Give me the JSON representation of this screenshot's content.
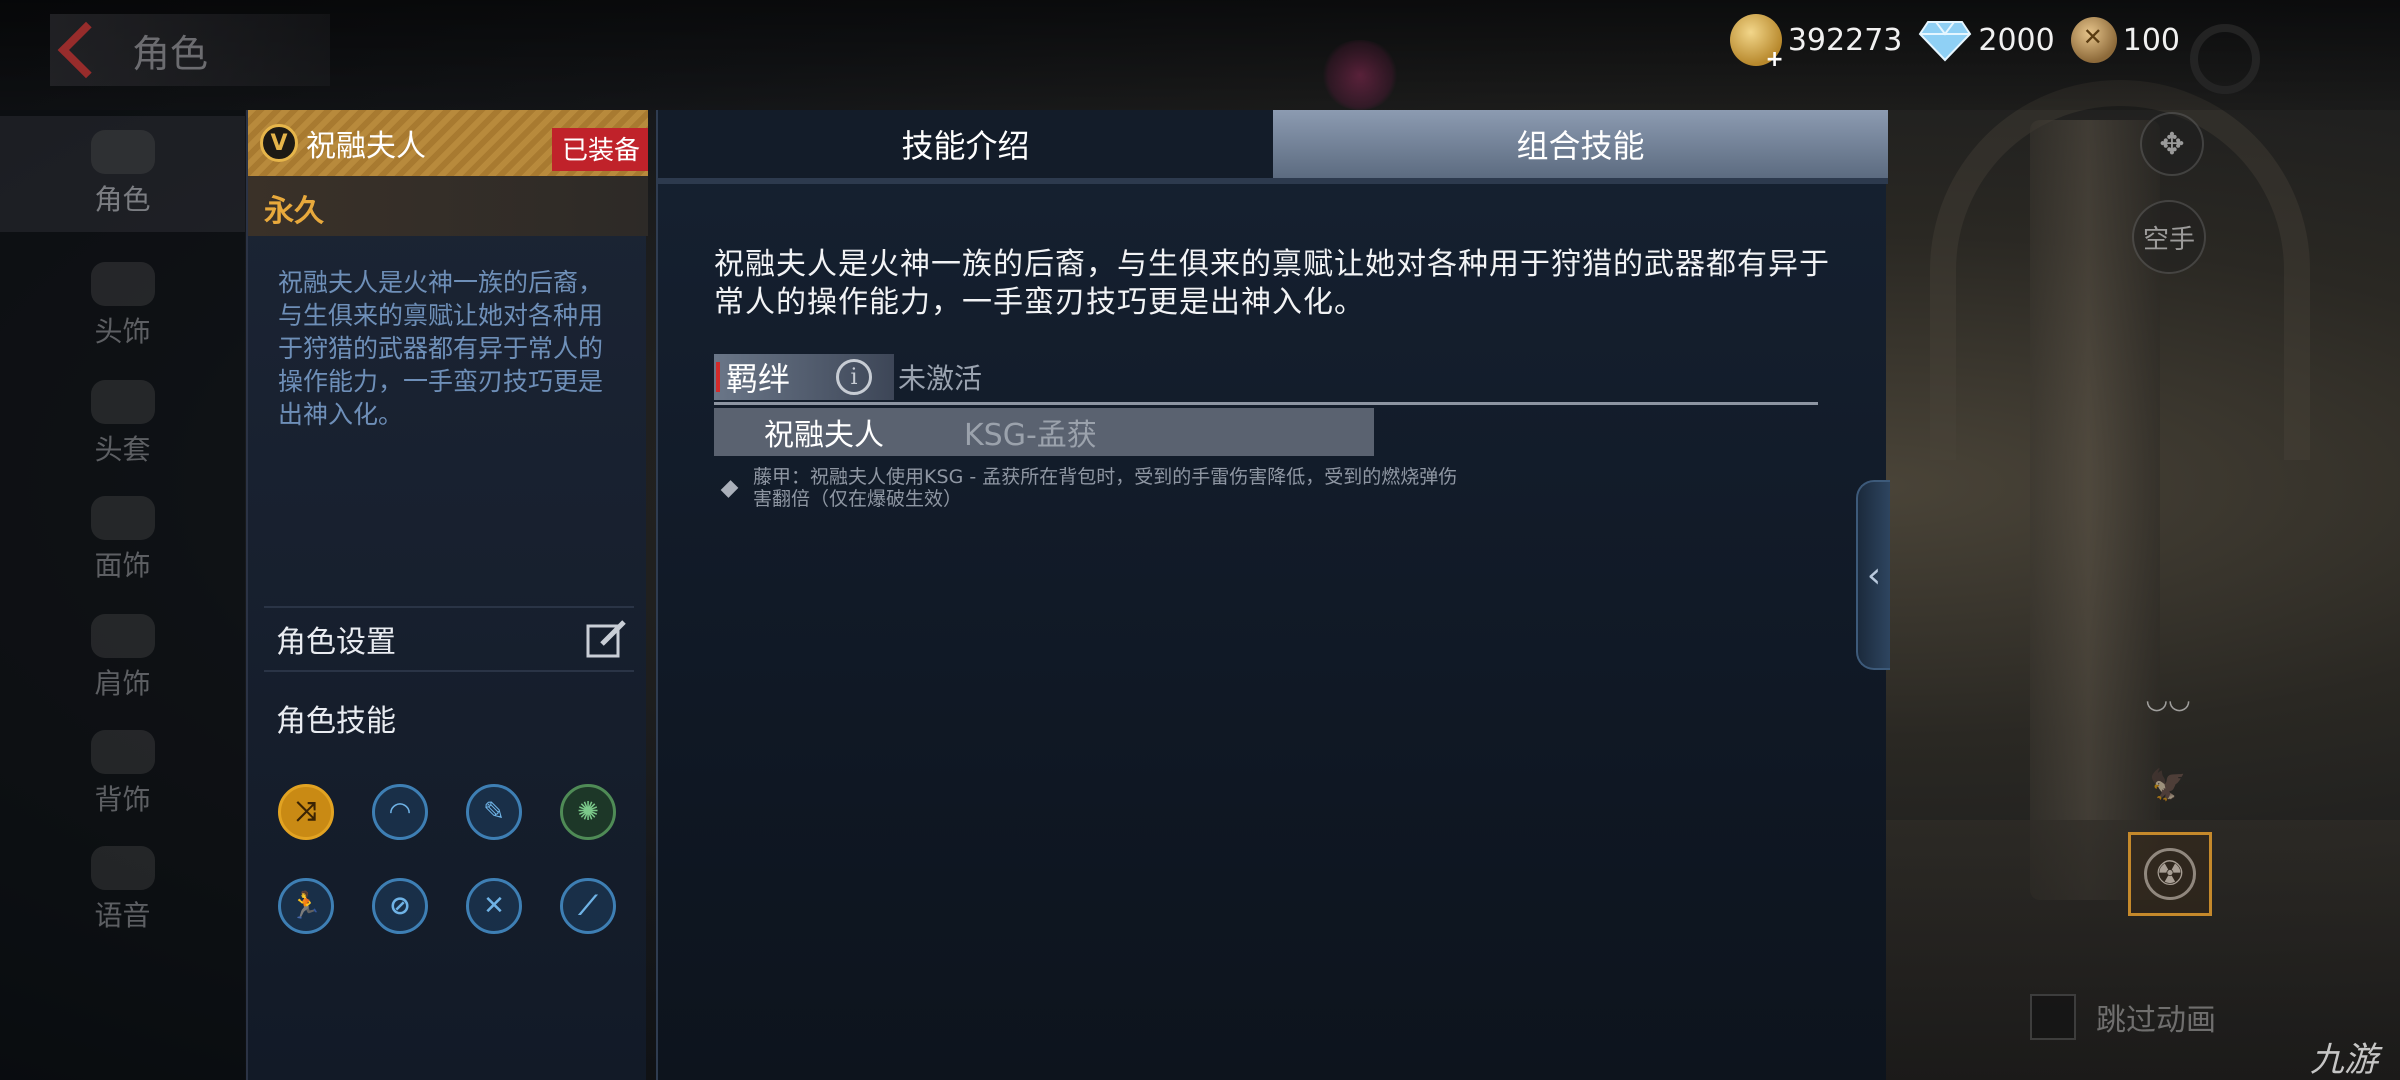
{
  "header": {
    "title": "角色"
  },
  "currencies": [
    {
      "icon": "gold-coin-icon",
      "value": "392273"
    },
    {
      "icon": "diamond-icon",
      "value": "2000"
    },
    {
      "icon": "medal-icon",
      "value": "100"
    }
  ],
  "nav": {
    "items": [
      {
        "label": "角色",
        "icon": "character-icon"
      },
      {
        "label": "头饰",
        "icon": "headwear-icon"
      },
      {
        "label": "头套",
        "icon": "hood-icon"
      },
      {
        "label": "面饰",
        "icon": "face-icon"
      },
      {
        "label": "肩饰",
        "icon": "shoulder-icon"
      },
      {
        "label": "背饰",
        "icon": "back-icon"
      },
      {
        "label": "语音",
        "icon": "voice-icon"
      }
    ]
  },
  "detail": {
    "badge": "V",
    "name": "祝融夫人",
    "equipped": "已装备",
    "duration": "永久",
    "description": "祝融夫人是火神一族的后裔，与生俱来的禀赋让她对各种用于狩猎的武器都有异于常人的操作能力，一手蛮刃技巧更是出神入化。",
    "settings_label": "角色设置",
    "skills_title": "角色技能"
  },
  "tabs": [
    {
      "label": "技能介绍"
    },
    {
      "label": "组合技能"
    }
  ],
  "main": {
    "description": "祝融夫人是火神一族的后裔，与生俱来的禀赋让她对各种用于狩猎的武器都有异于常人的操作能力，一手蛮刃技巧更是出神入化。",
    "bond_label": "羁绊",
    "bond_status": "未激活",
    "combo_character": "祝融夫人",
    "combo_weapon": "KSG-孟获",
    "effect_text": "藤甲：祝融夫人使用KSG - 孟获所在背包时，受到的手雷伤害降低，受到的燃烧弹伤害翻倍（仅在爆破生效）"
  },
  "hud": {
    "empty_hand": "空手",
    "skip_animation": "跳过动画",
    "watermark": "九游"
  },
  "colors": {
    "accent_gold": "#e8a93c",
    "equipped_red": "#c0222a",
    "desc_blue": "#6e8fb8"
  }
}
